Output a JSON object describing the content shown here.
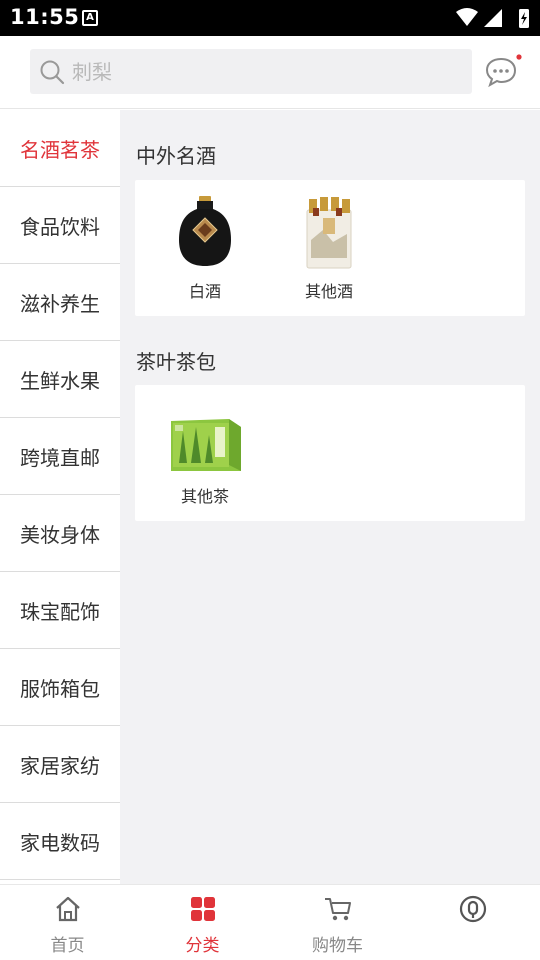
{
  "status_bar": {
    "time": "11:55",
    "notification_icon": "A"
  },
  "search": {
    "placeholder": "刺梨"
  },
  "icons": {
    "search": "search-icon",
    "message": "message-bubble-icon"
  },
  "colors": {
    "accent": "#e0343a",
    "content_bg": "#f2f2f4"
  },
  "sidebar": {
    "items": [
      {
        "label": "名酒茗茶",
        "active": true
      },
      {
        "label": "食品饮料"
      },
      {
        "label": "滋补养生"
      },
      {
        "label": "生鲜水果"
      },
      {
        "label": "跨境直邮"
      },
      {
        "label": "美妆身体"
      },
      {
        "label": "珠宝配饰"
      },
      {
        "label": "服饰箱包"
      },
      {
        "label": "家居家纺"
      },
      {
        "label": "家电数码"
      }
    ]
  },
  "sections": [
    {
      "title": "中外名酒",
      "items": [
        {
          "label": "白酒"
        },
        {
          "label": "其他酒"
        }
      ]
    },
    {
      "title": "茶叶茶包",
      "items": [
        {
          "label": "其他茶"
        }
      ]
    }
  ],
  "tabbar": {
    "items": [
      {
        "label": "首页",
        "icon": "home-icon"
      },
      {
        "label": "分类",
        "icon": "category-grid-icon",
        "active": true
      },
      {
        "label": "购物车",
        "icon": "cart-icon"
      },
      {
        "label": "",
        "icon": "profile-icon"
      }
    ]
  }
}
